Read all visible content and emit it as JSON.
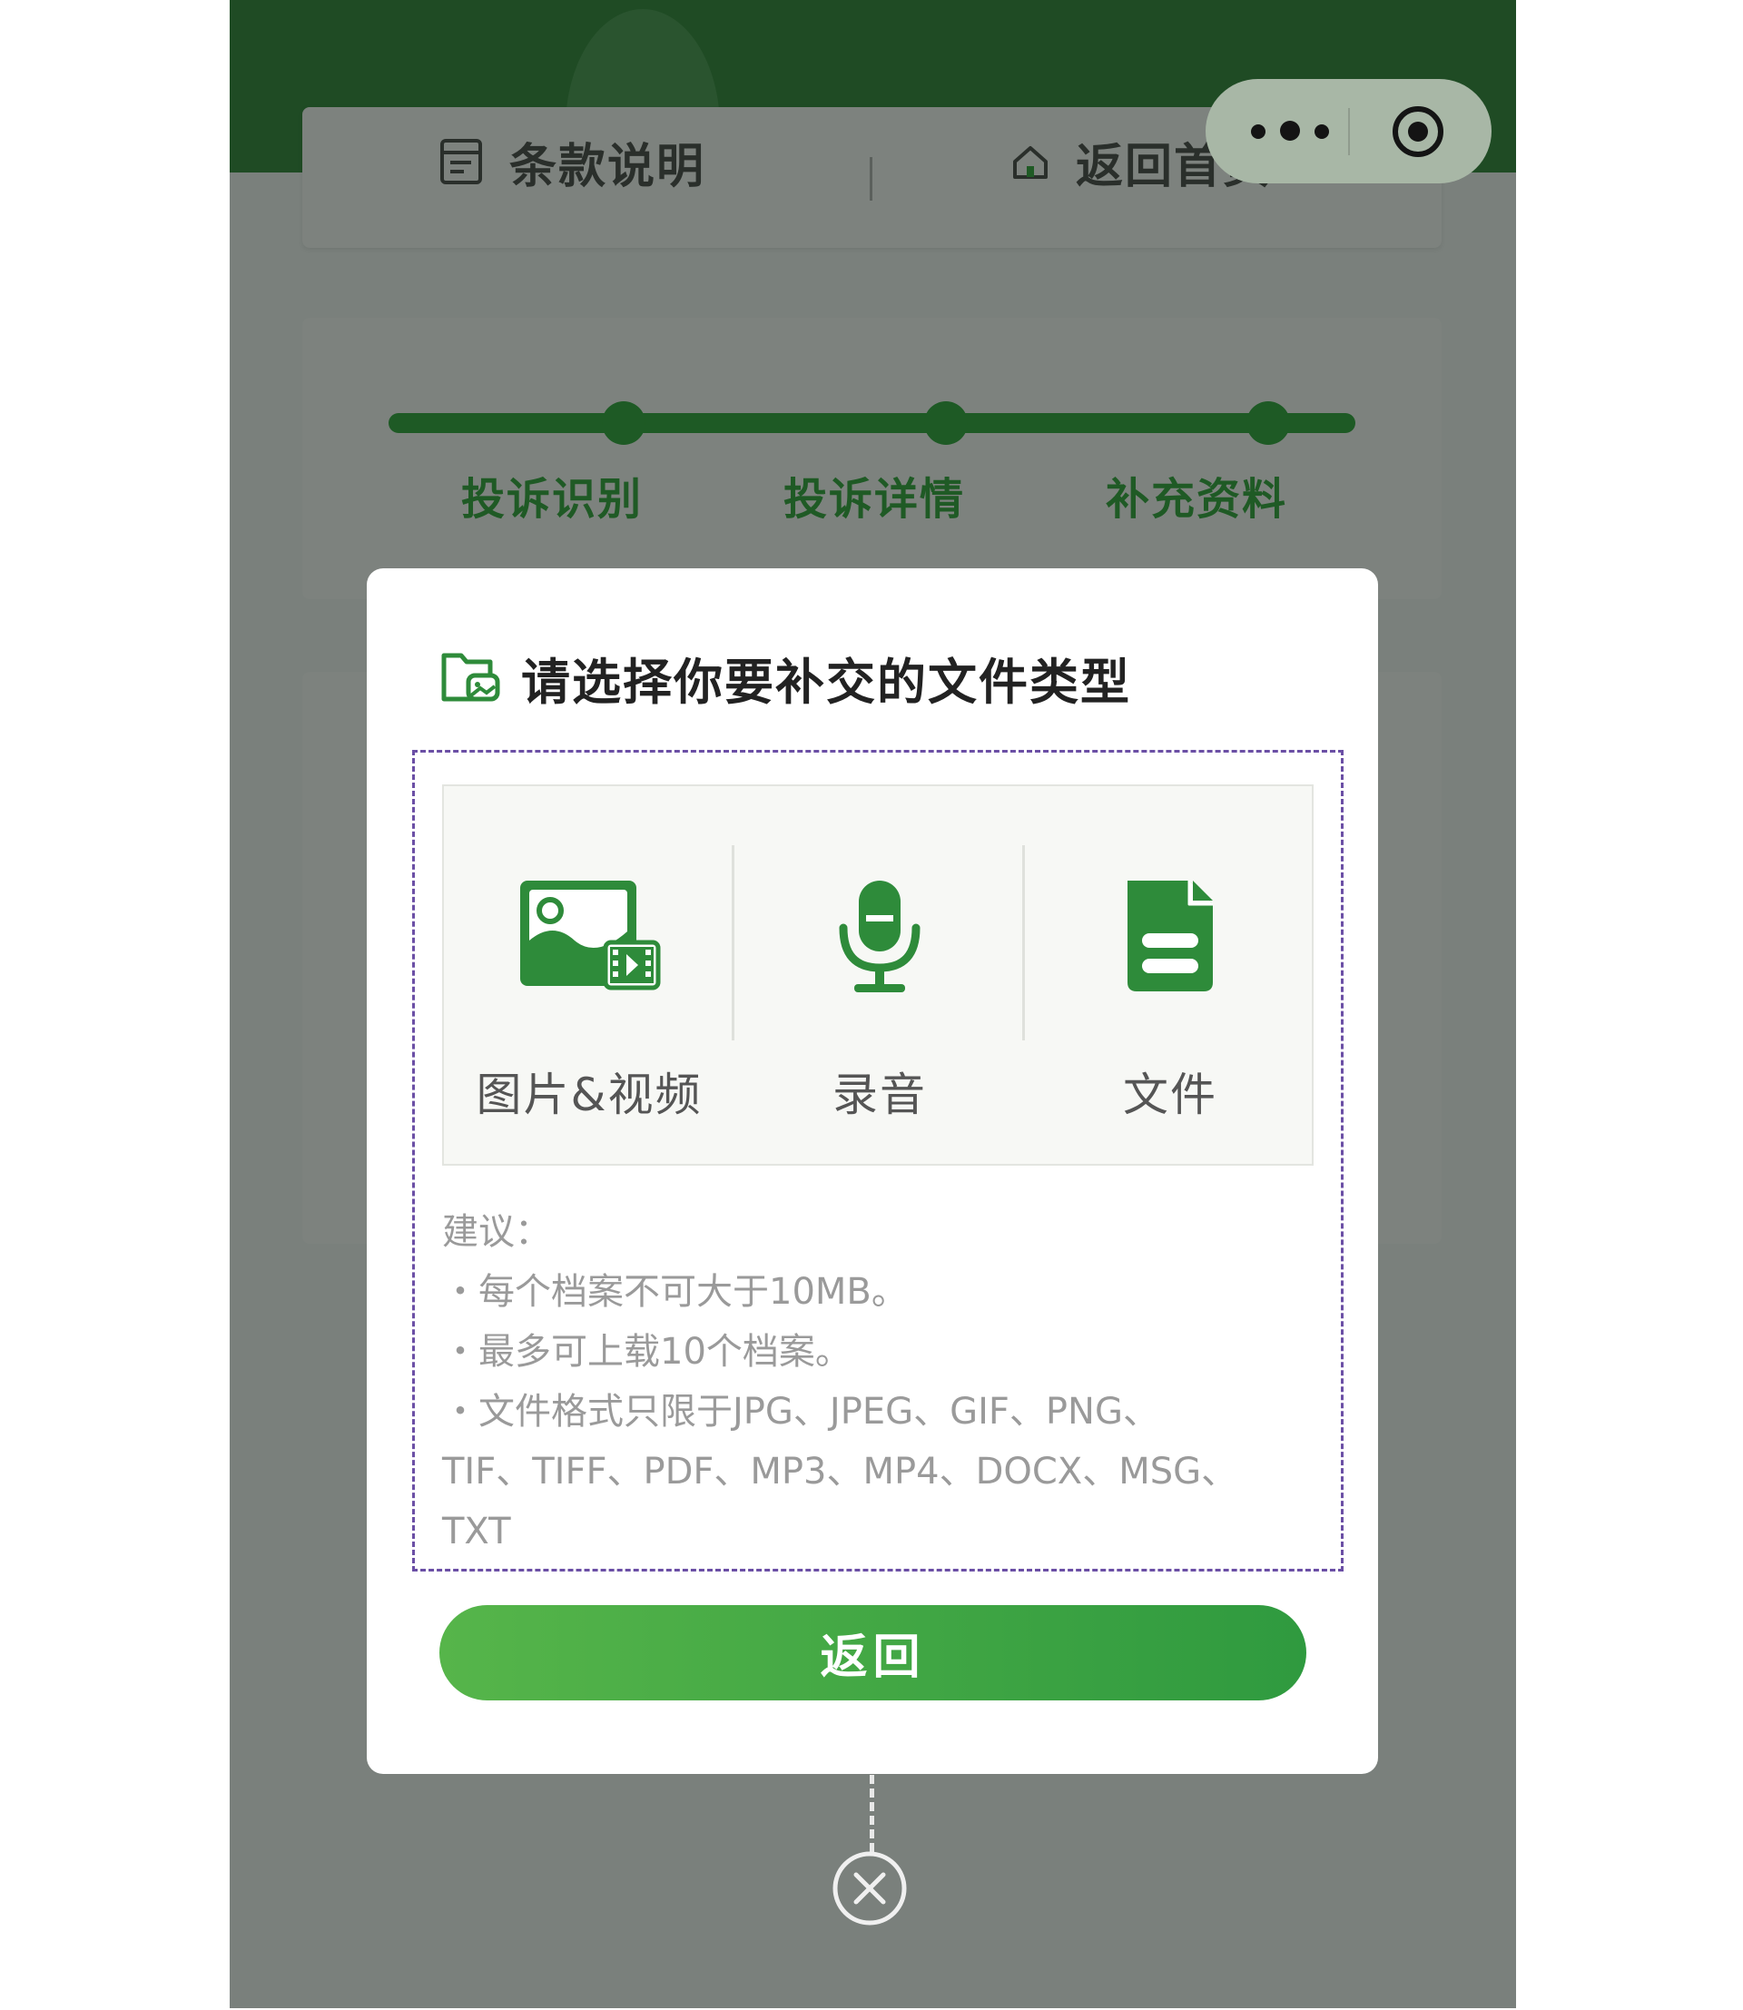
{
  "top_nav": {
    "terms_label": "条款说明",
    "home_label": "返回首页"
  },
  "steps": [
    "投诉识别",
    "投诉详情",
    "补充资料"
  ],
  "modal": {
    "title": "请选择你要补交的文件类型",
    "options": [
      {
        "label": "图片&视频",
        "icon": "image-video-icon"
      },
      {
        "label": "录音",
        "icon": "microphone-icon"
      },
      {
        "label": "文件",
        "icon": "document-icon"
      }
    ],
    "advice": {
      "heading": "建议：",
      "line1": "・每个档案不可大于10MB。",
      "line2": "・最多可上载10个档案。",
      "line3": "・文件格式只限于JPG、JPEG、GIF、PNG、",
      "line4": "TIF、TIFF、PDF、MP3、MP4、DOCX、MSG、",
      "line5": "TXT"
    },
    "back_label": "返回"
  },
  "colors": {
    "header_green": "#1f4b24",
    "accent_green": "#2e8b3a",
    "button_gradient_start": "#56b54a",
    "button_gradient_end": "#2f9a3f",
    "overlay": "#7a807c",
    "dashed_border": "#6b4fa5"
  }
}
